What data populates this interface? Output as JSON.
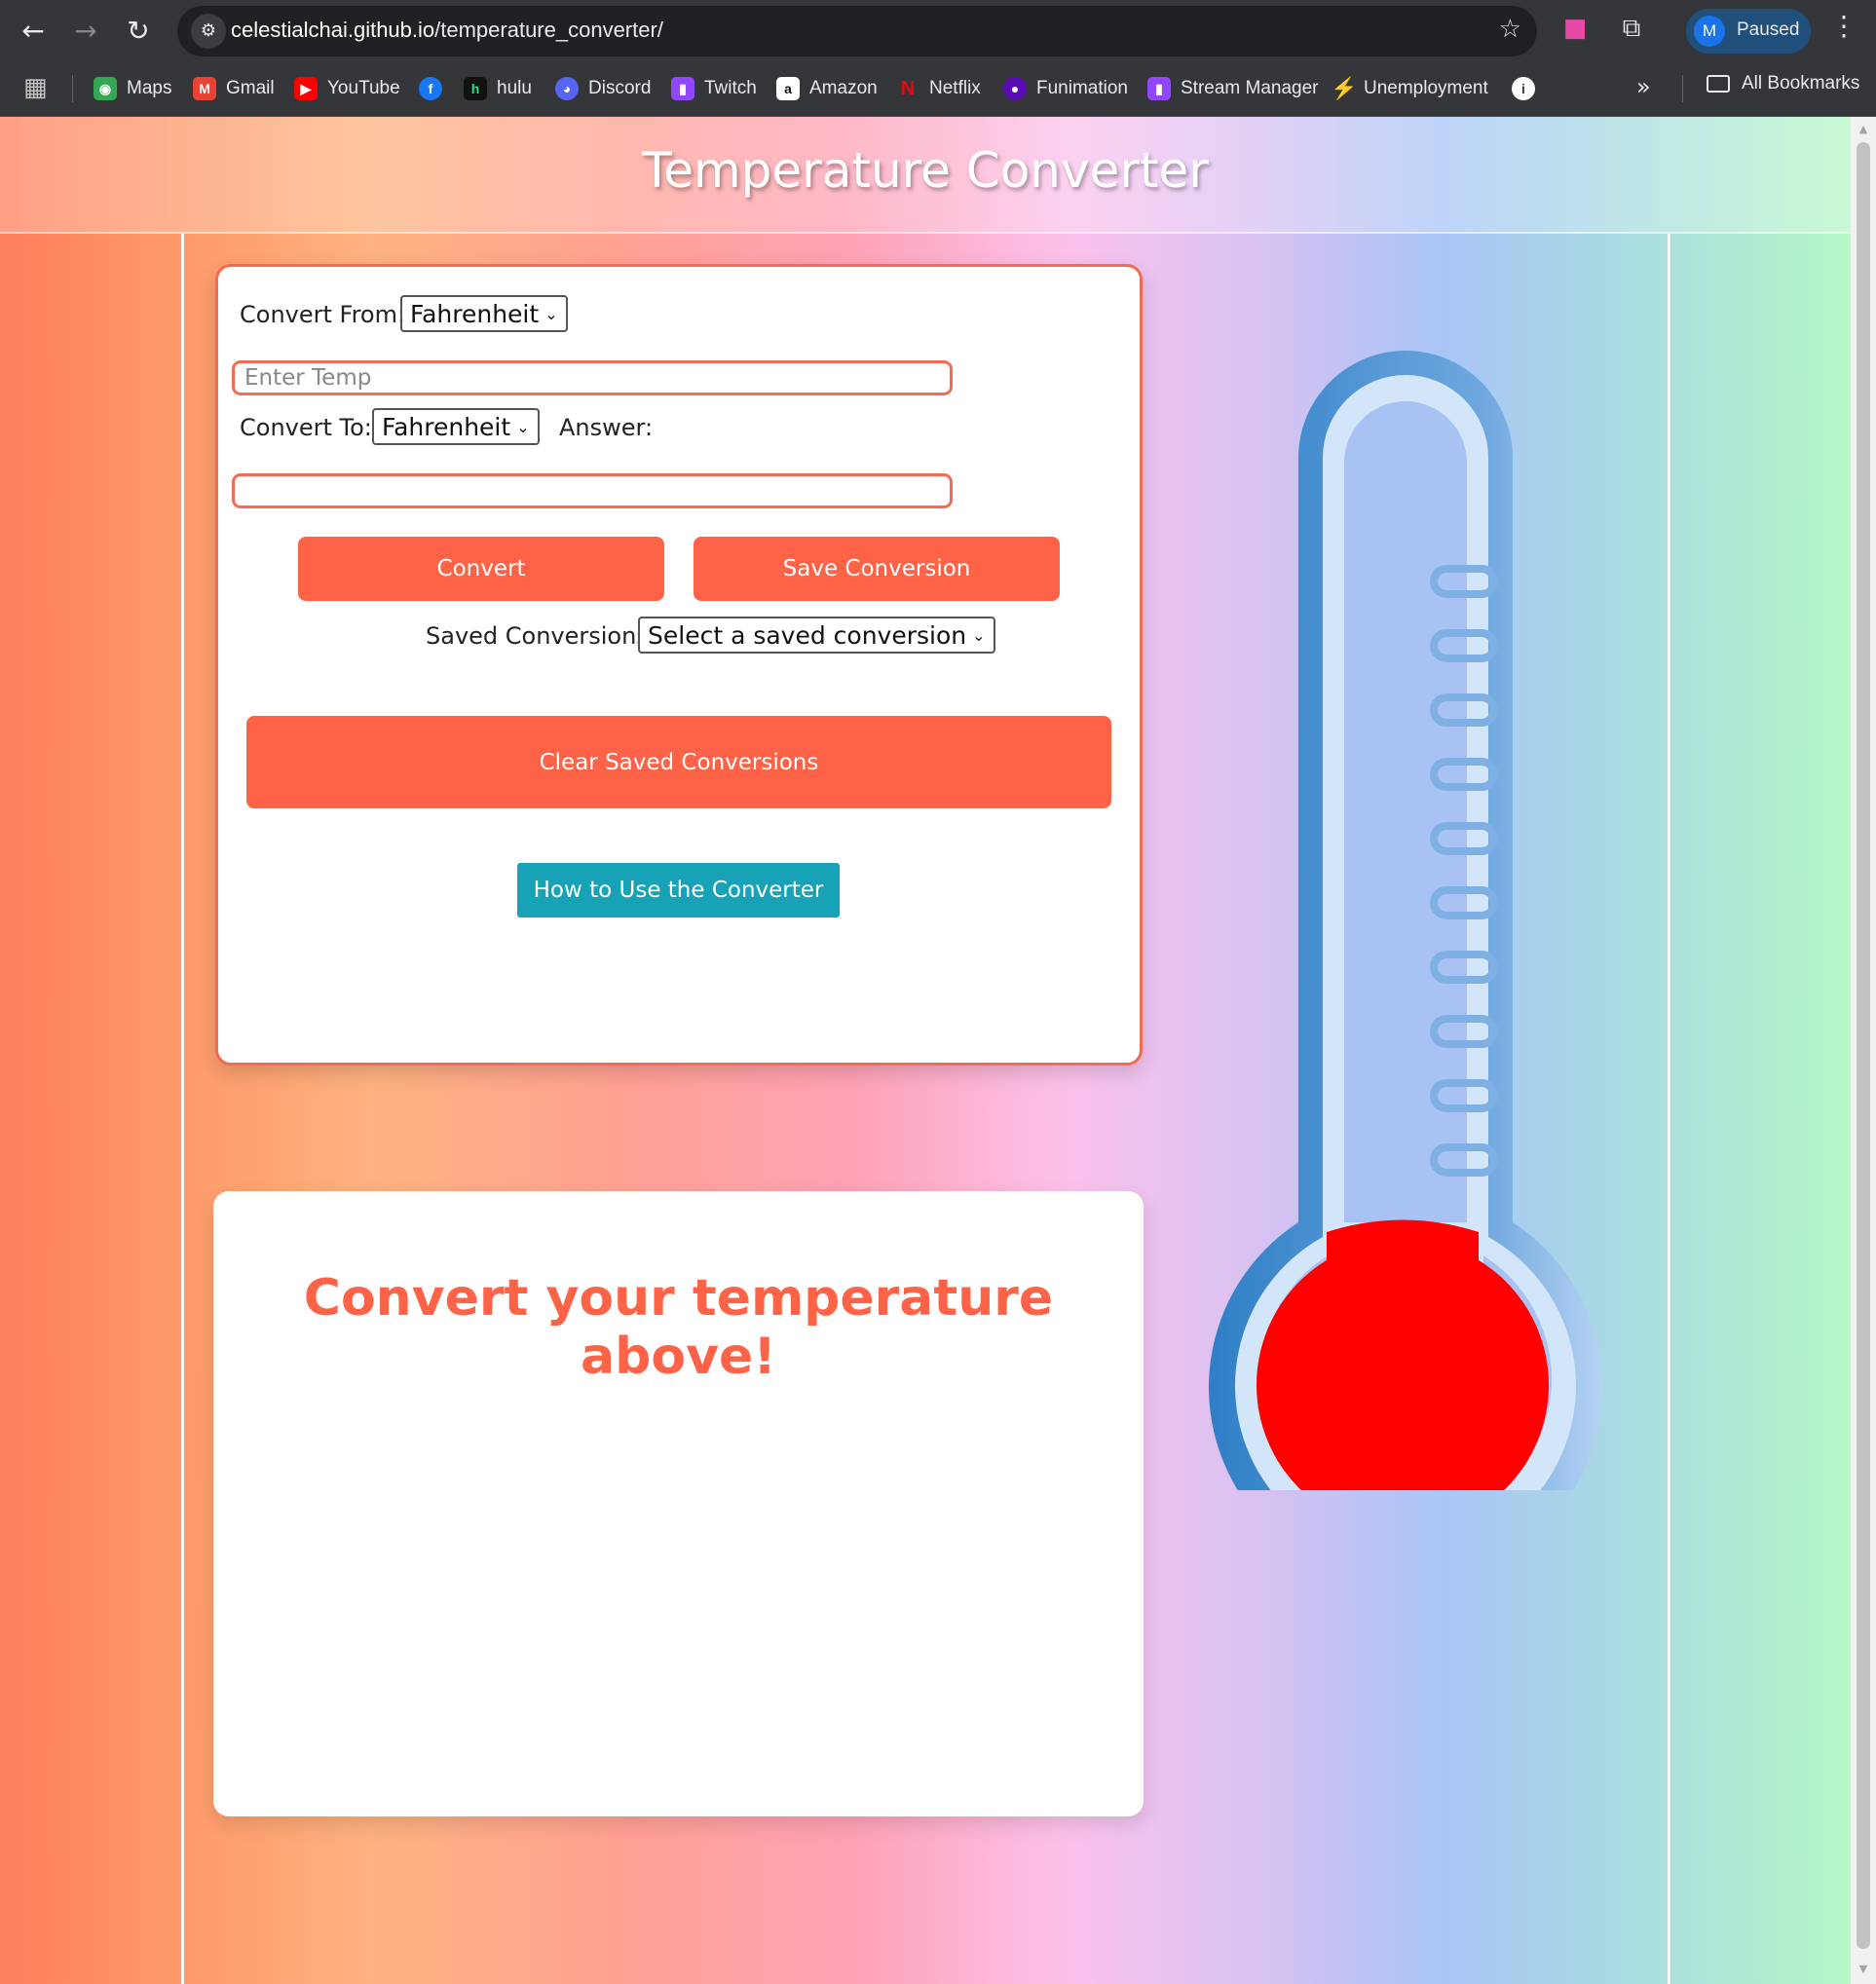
{
  "browser": {
    "url_host": "celestialchai.github.io",
    "url_path": "/temperature_converter/",
    "profile_initial": "M",
    "profile_status": "Paused",
    "bookmarks": [
      {
        "label": "Maps",
        "icon": "maps-icon",
        "color": "#34a853"
      },
      {
        "label": "Gmail",
        "icon": "gmail-icon",
        "color": "#ea4335"
      },
      {
        "label": "YouTube",
        "icon": "youtube-icon",
        "color": "#ff0000"
      },
      {
        "label": "",
        "icon": "facebook-icon",
        "color": "#1877f2"
      },
      {
        "label": "hulu",
        "icon": "hulu-icon",
        "color": "#1ce783"
      },
      {
        "label": "Discord",
        "icon": "discord-icon",
        "color": "#5865f2"
      },
      {
        "label": "Twitch",
        "icon": "twitch-icon",
        "color": "#9146ff"
      },
      {
        "label": "Amazon",
        "icon": "amazon-icon",
        "color": "#ffffff"
      },
      {
        "label": "Netflix",
        "icon": "netflix-icon",
        "color": "#e50914"
      },
      {
        "label": "Funimation",
        "icon": "funimation-icon",
        "color": "#5b0bb5"
      },
      {
        "label": "Stream Manager",
        "icon": "twitch-icon",
        "color": "#9146ff"
      },
      {
        "label": "Unemployment",
        "icon": "bolt-icon",
        "color": "#f9d71c"
      },
      {
        "label": "",
        "icon": "info-icon",
        "color": "#ffffff"
      }
    ],
    "all_bookmarks_label": "All Bookmarks"
  },
  "page": {
    "title": "Temperature Converter",
    "accent": "#ff6347"
  },
  "converter": {
    "from_label": "Convert From:",
    "from_value": "Fahrenheit",
    "temp_placeholder": "Enter Temp",
    "temp_value": "",
    "to_label": "Convert To:",
    "to_value": "Fahrenheit",
    "answer_label": "Answer:",
    "answer_value": "",
    "convert_label": "Convert",
    "save_label": "Save Conversion",
    "saved_label": "Saved Conversions:",
    "saved_value": "Select a saved conversion",
    "clear_label": "Clear Saved Conversions",
    "help_label": "How to Use the Converter"
  },
  "results": {
    "message": "Convert your temperature above!"
  }
}
